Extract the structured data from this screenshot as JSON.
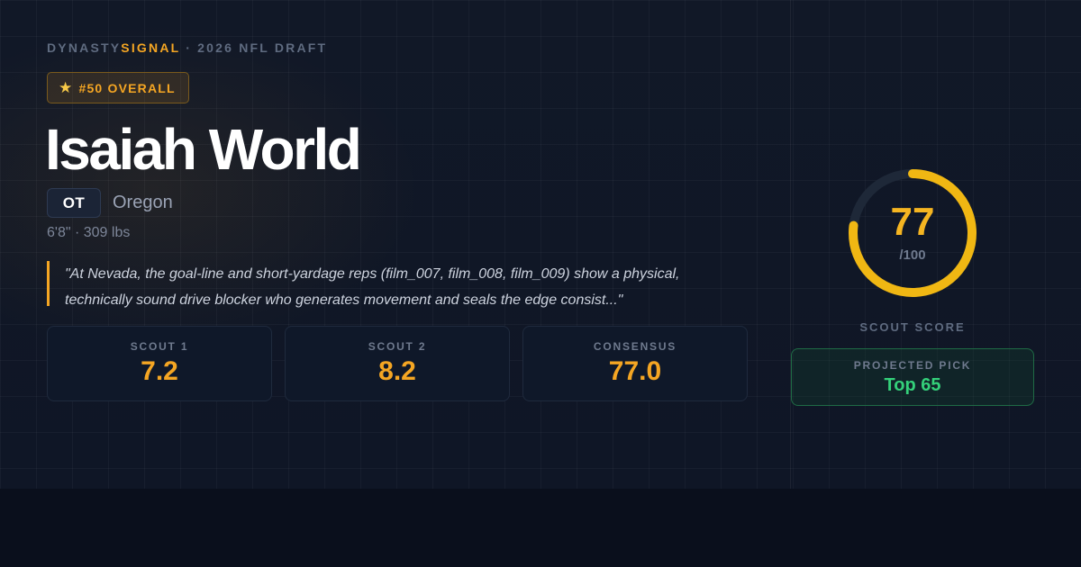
{
  "header": {
    "brand_primary": "DYNASTY",
    "brand_accent": "SIGNAL",
    "subtitle": " · 2026 NFL DRAFT"
  },
  "rank_badge": {
    "icon": "star-icon",
    "label": "#50 OVERALL"
  },
  "player": {
    "name": "Isaiah World",
    "position": "OT",
    "school": "Oregon",
    "measurables": "6'8\" · 309 lbs"
  },
  "quote": "\"At Nevada, the goal-line and short-yardage reps (film_007, film_008, film_009) show a physical, technically sound drive blocker who generates movement and seals the edge consist...\"",
  "stats": [
    {
      "label": "SCOUT 1",
      "value": "7.2"
    },
    {
      "label": "SCOUT 2",
      "value": "8.2"
    },
    {
      "label": "CONSENSUS",
      "value": "77.0"
    }
  ],
  "score": {
    "value": "77",
    "max_label": "/100",
    "fraction": 0.77,
    "label": "SCOUT SCORE"
  },
  "projected_pick": {
    "label": "PROJECTED PICK",
    "value": "Top 65"
  },
  "colors": {
    "accent": "#f5a623",
    "gauge": "#f0b713",
    "pick": "#34d17a",
    "background": "#111827"
  }
}
